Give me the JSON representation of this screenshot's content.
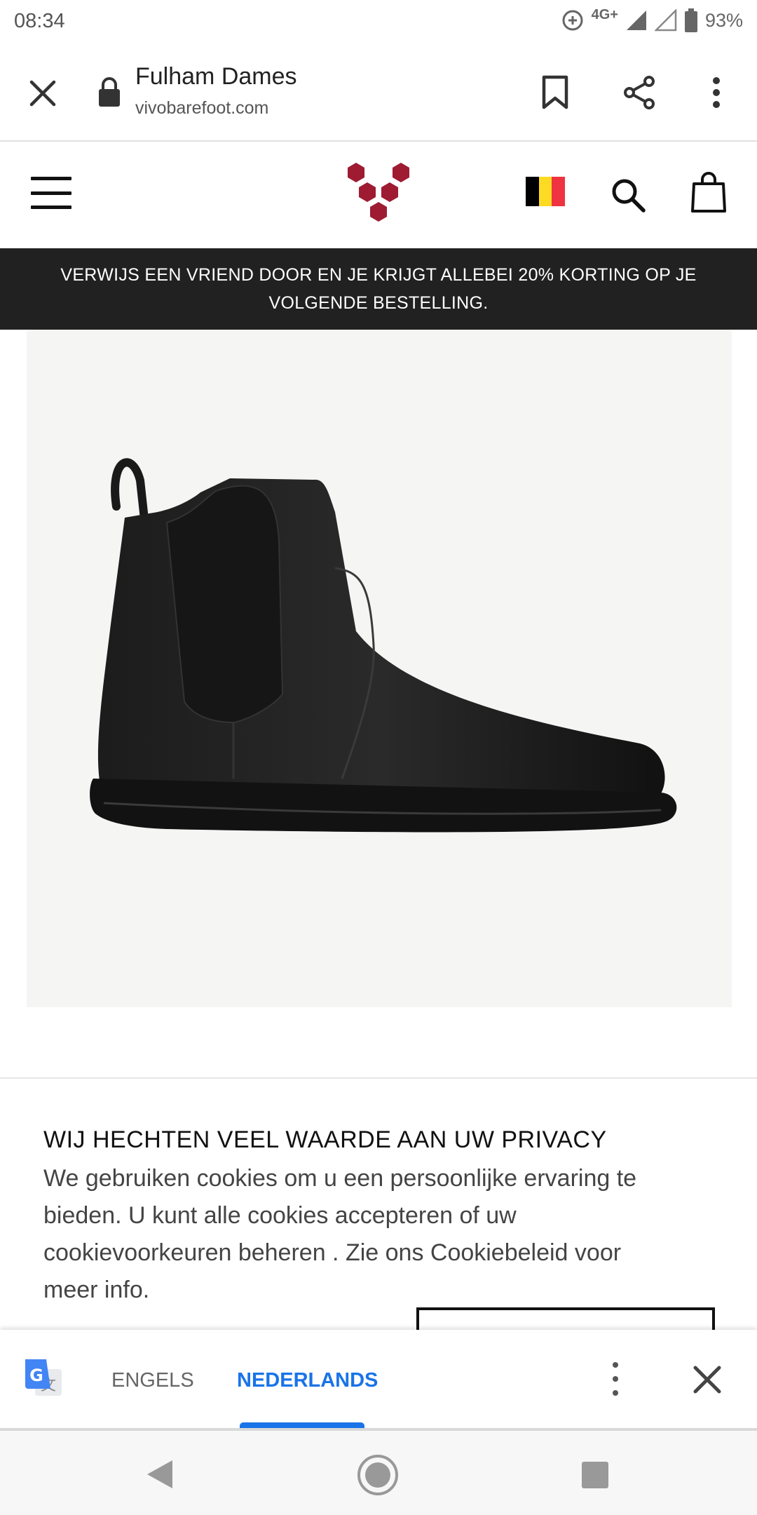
{
  "status_bar": {
    "time": "08:34",
    "network": "4G+",
    "battery": "93%"
  },
  "toolbar": {
    "title": "Fulham Dames",
    "url": "vivobarefoot.com"
  },
  "promo_banner": {
    "text": "VERWIJS EEN VRIEND DOOR EN JE KRIJGT ALLEBEI 20% KORTING OP JE VOLGENDE BESTELLING."
  },
  "header": {
    "logo_color": "#9e1b32",
    "flag_colors": [
      "#000000",
      "#fdda24",
      "#ef3340"
    ]
  },
  "cookie": {
    "title": "WIJ HECHTEN VEEL WAARDE AAN UW PRIVACY",
    "body": "We gebruiken cookies om u een persoonlijke ervaring te bieden. U kunt alle cookies accepteren of uw cookievoorkeuren beheren . Zie ons Cookiebeleid voor meer info."
  },
  "translate_bar": {
    "languages": [
      "ENGELS",
      "NEDERLANDS"
    ],
    "selected": "NEDERLANDS",
    "accent_color": "#1a73e8"
  }
}
